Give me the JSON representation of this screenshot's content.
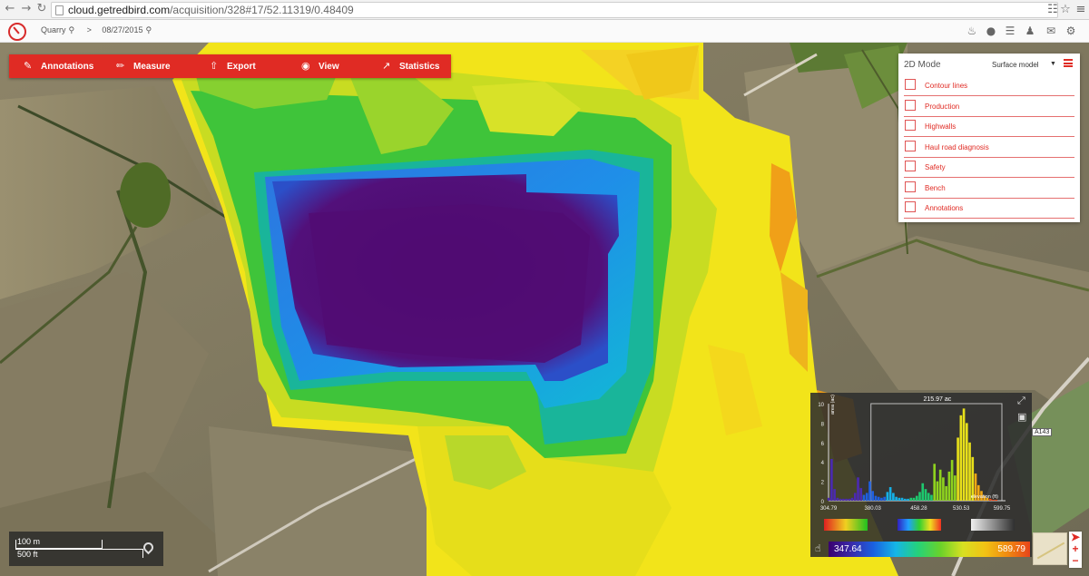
{
  "browser": {
    "url_domain": "cloud.getredbird.com",
    "url_path": "/acquisition/328#17/52.11319/0.48409",
    "nav_icons": [
      "back-icon",
      "forward-icon",
      "reload-icon"
    ],
    "right_icons": [
      "translate-icon",
      "star-icon",
      "menu-icon"
    ]
  },
  "header": {
    "site": "Quarry",
    "separator": ">",
    "date": "08/27/2015",
    "icons": [
      "bell-icon",
      "globe-icon",
      "list-icon",
      "users-icon",
      "mail-icon",
      "gear-icon"
    ]
  },
  "toolbar": {
    "annotations": "Annotations",
    "measure": "Measure",
    "export": "Export",
    "view": "View",
    "statistics": "Statistics"
  },
  "layers": {
    "mode_label": "2D Mode",
    "model_select": "Surface model",
    "items": [
      "Contour lines",
      "Production",
      "Highwalls",
      "Haul road diagnosis",
      "Safety",
      "Bench",
      "Annotations"
    ]
  },
  "scale": {
    "metric": "100 m",
    "imperial": "500 ft"
  },
  "road_label": "A143",
  "histogram": {
    "area_label": "215.97 ac",
    "y_axis_label": "area (ac)",
    "x_axis_label": "elevation (ft)",
    "y_ticks": [
      "0",
      "2",
      "4",
      "6",
      "8",
      "10"
    ],
    "x_ticks": [
      "304.79",
      "380.03",
      "458.28",
      "530.53",
      "599.75"
    ],
    "range_min": "347.64",
    "range_max": "589.79",
    "palettes": [
      "rainbow",
      "spectral",
      "grayscale"
    ],
    "accent": "#e02b24"
  },
  "chart_data": {
    "type": "bar",
    "title": "215.97 ac",
    "xlabel": "elevation (ft)",
    "ylabel": "area (ac)",
    "xlim": [
      304.79,
      599.75
    ],
    "ylim": [
      0,
      10
    ],
    "x": [
      305,
      310,
      315,
      320,
      325,
      330,
      335,
      340,
      345,
      350,
      355,
      360,
      365,
      370,
      375,
      380,
      385,
      390,
      395,
      400,
      405,
      410,
      415,
      420,
      425,
      430,
      435,
      440,
      445,
      450,
      455,
      460,
      465,
      470,
      475,
      480,
      485,
      490,
      495,
      500,
      505,
      510,
      515,
      520,
      525,
      530,
      535,
      540,
      545,
      550,
      555,
      560,
      565,
      570,
      575,
      580,
      585,
      590,
      595
    ],
    "values": [
      0.3,
      4.3,
      1.2,
      0.3,
      0.2,
      0.2,
      0.2,
      0.2,
      0.3,
      0.8,
      2.4,
      1.3,
      0.6,
      0.8,
      2.0,
      1.0,
      0.5,
      0.4,
      0.3,
      0.4,
      0.9,
      1.4,
      0.8,
      0.4,
      0.3,
      0.3,
      0.2,
      0.2,
      0.3,
      0.3,
      0.5,
      0.9,
      1.8,
      1.2,
      0.8,
      0.6,
      3.8,
      2.0,
      3.2,
      2.4,
      1.5,
      3.0,
      4.2,
      2.6,
      6.5,
      8.8,
      9.5,
      8.0,
      6.0,
      4.5,
      2.8,
      1.6,
      1.0,
      0.5,
      0.3,
      0.2,
      0.1,
      0.1,
      0.0
    ]
  }
}
